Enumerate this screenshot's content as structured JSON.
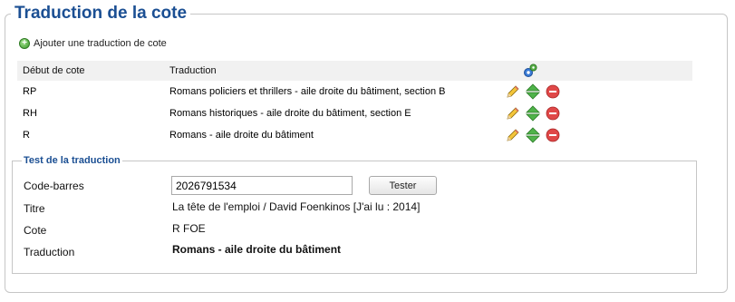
{
  "section_title": "Traduction de la cote",
  "add_label": "Ajouter une traduction de cote",
  "table": {
    "headers": [
      "Début de cote",
      "Traduction"
    ],
    "rows": [
      {
        "code": "RP",
        "translation": "Romans policiers et thrillers - aile droite du bâtiment, section B"
      },
      {
        "code": "RH",
        "translation": "Romans historiques - aile droite du bâtiment, section E"
      },
      {
        "code": "R",
        "translation": "Romans - aile droite du bâtiment"
      }
    ]
  },
  "test": {
    "legend": "Test de la traduction",
    "barcode_label": "Code-barres",
    "barcode_value": "2026791534",
    "test_button": "Tester",
    "title_label": "Titre",
    "title_value": "La tête de l'emploi / David Foenkinos [J'ai lu : 2014]",
    "cote_label": "Cote",
    "cote_value": "R FOE",
    "traduction_label": "Traduction",
    "traduction_value": "Romans - aile droite du bâtiment"
  },
  "icons": {
    "add": "add-circle-icon",
    "header": "gear-icon",
    "edit": "pencil-icon",
    "move": "up-down-arrows-icon",
    "delete": "delete-icon"
  },
  "colors": {
    "title": "#1b4f93",
    "add_green": "#3c9a2c",
    "delete_red": "#d9363e",
    "header_bg": "#f1f1f1"
  }
}
